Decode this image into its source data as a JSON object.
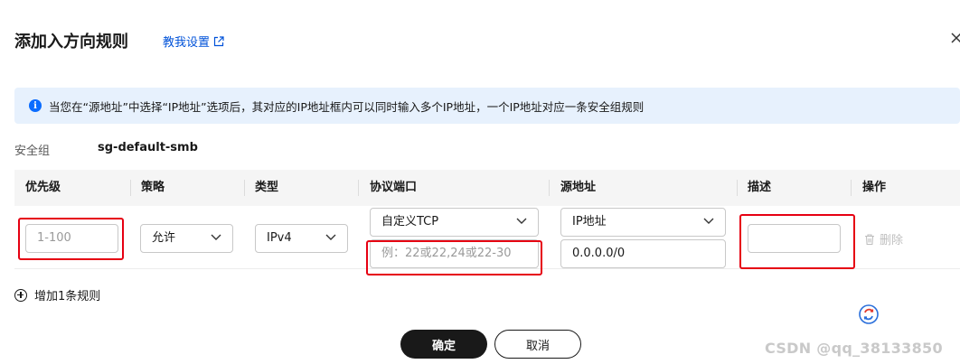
{
  "dialog": {
    "title": "添加入方向规则",
    "help_link": "教我设置",
    "close_icon": "close-icon"
  },
  "notice": {
    "text": "当您在“源地址”中选择“IP地址”选项后，其对应的IP地址框内可以同时输入多个IP地址，一个IP地址对应一条安全组规则"
  },
  "security_group": {
    "label": "安全组",
    "value": "sg-default-smb"
  },
  "table": {
    "headers": [
      "优先级",
      "策略",
      "类型",
      "协议端口",
      "源地址",
      "描述",
      "操作"
    ],
    "row": {
      "priority": {
        "value": "",
        "placeholder": "1-100"
      },
      "policy": "允许",
      "type": "IPv4",
      "protocol": "自定义TCP",
      "port": {
        "value": "",
        "placeholder": "例：22或22,24或22-30"
      },
      "source_type": "IP地址",
      "source_value": "0.0.0.0/0",
      "description": {
        "value": "",
        "placeholder": ""
      },
      "delete_label": "删除"
    }
  },
  "add_row_label": "增加1条规则",
  "buttons": {
    "ok": "确定",
    "cancel": "取消"
  },
  "watermark": "CSDN @qq_38133850",
  "colors": {
    "accent_link": "#0052d9",
    "notice_bg": "#e7f1fd",
    "highlight_box": "#e60012",
    "primary_button": "#191919"
  }
}
